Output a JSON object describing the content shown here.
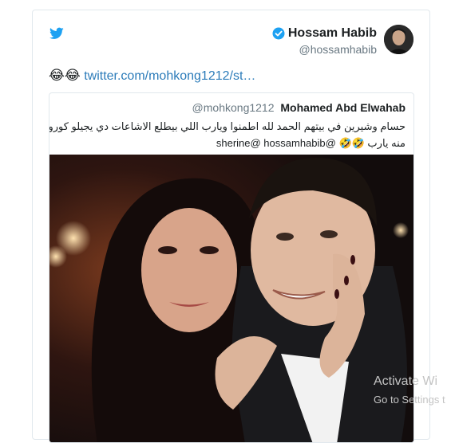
{
  "tweet": {
    "author_name": "Hossam Habib",
    "author_handle": "@hossamhabib",
    "emojis": "😂😂",
    "link_text": "twitter.com/mohkong1212/st…",
    "colors": {
      "link": "#2b7bb9",
      "twitter_blue": "#1da1f2",
      "text": "#1c2022",
      "muted": "#697882"
    }
  },
  "quoted": {
    "handle": "@mohkong1212",
    "name": "Mohamed Abd Elwahab",
    "line1": "حسام وشيرين في بيتهم الحمد لله اطمنوا ويارب اللي بيطلع الاشاعات دي يجيلو كورونا ونخلص",
    "line2": "منه يارب 🤣🤣 @sherine@ hossamhabib"
  },
  "os_watermark": {
    "title": "Activate Wi",
    "subtitle": "Go to Settings t"
  }
}
